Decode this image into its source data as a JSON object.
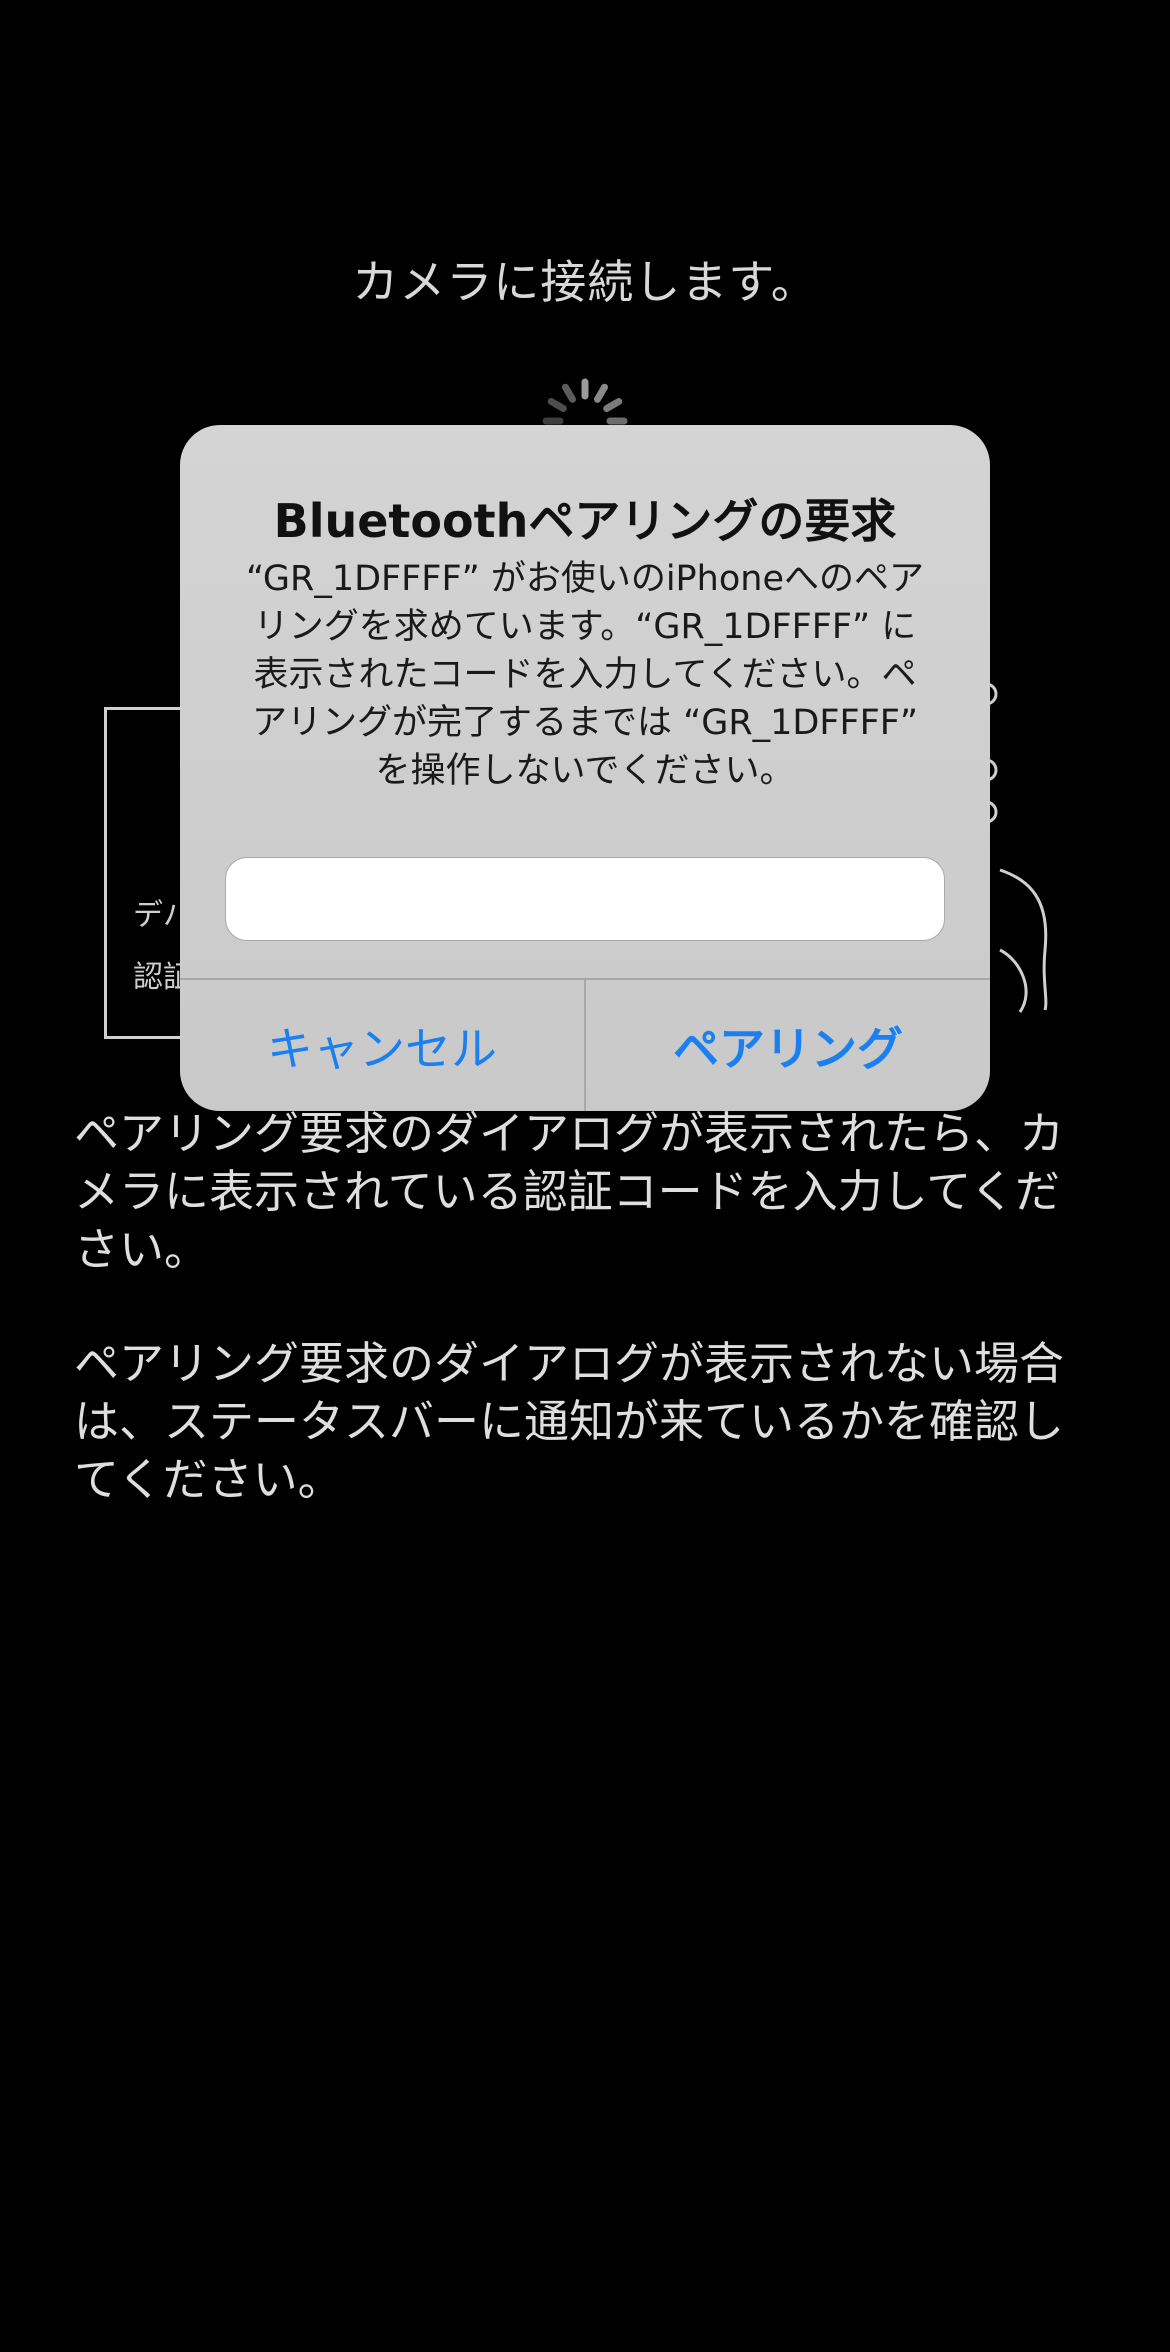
{
  "screen": {
    "heading": "カメラに接続します。",
    "illustration": {
      "line1": "デバ",
      "line2": "認証"
    },
    "instructions": [
      "ペアリング要求のダイアログが表示されたら、カメラに表示されている認証コードを入力してください。",
      "ペアリング要求のダイアログが表示されない場合は、ステータスバーに通知が来ているかを確認してください。"
    ]
  },
  "dialog": {
    "title": "Bluetoothペアリングの要求",
    "message": "“GR_1DFFFF” がお使いのiPhoneへのペア\nリングを求めています。“GR_1DFFFF” に\n表示されたコードを入力してください。ペ\nアリングが完了するまでは “GR_1DFFFF”\nを操作しないでください。",
    "input_value": "",
    "cancel_label": "キャンセル",
    "pair_label": "ペアリング"
  },
  "colors": {
    "background": "#000000",
    "dialog_bg": "#cfcfcf",
    "accent": "#1a7ff0"
  }
}
